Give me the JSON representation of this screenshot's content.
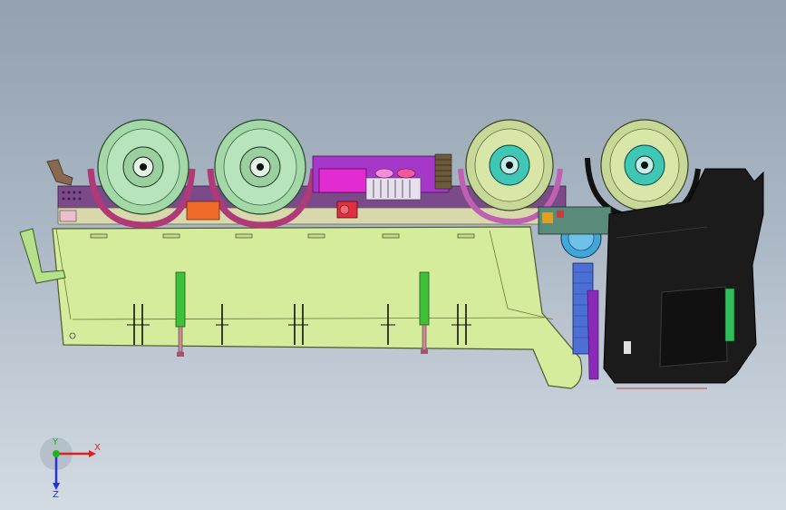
{
  "viewport": {
    "background_top": "#93a1b0",
    "background_bottom": "#d3dbe3"
  },
  "model": {
    "body_color": "#d4ec9c",
    "chassis_color": "#7b4a8a",
    "tire_color_rear": "#b5e0b8",
    "tire_color_front": "#d3e4a6",
    "hub_color_front": "#3fc7b5",
    "cab_color": "#1b1b1b",
    "mudguard_color": "#b03a78",
    "frame_accent": "#a538c9",
    "tank_color": "#41a6d8",
    "exhaust_color": "#4c6fd6"
  },
  "triad": {
    "x_label": "X",
    "y_label": "Y",
    "z_label": "Z",
    "x_color": "#e0201e",
    "y_color": "#21b21e",
    "z_color": "#2233d8"
  }
}
